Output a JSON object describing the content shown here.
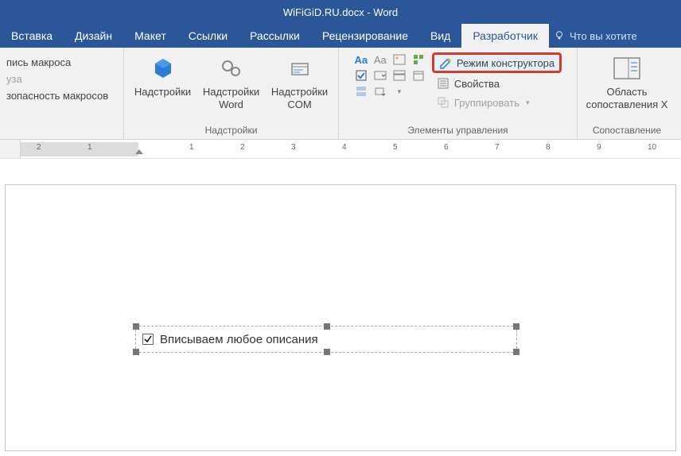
{
  "title": "WiFiGiD.RU.docx - Word",
  "tabs": [
    "Вставка",
    "Дизайн",
    "Макет",
    "Ссылки",
    "Рассылки",
    "Рецензирование",
    "Вид",
    "Разработчик"
  ],
  "active_tab": 7,
  "tell_me": "Что вы хотите",
  "code": {
    "record": "пись макроса",
    "pause": "уза",
    "security": "зопасность макросов"
  },
  "addins": {
    "label": "Надстройки",
    "items": [
      "Надстройки",
      "Надстройки Word",
      "Надстройки COM"
    ]
  },
  "controls": {
    "label": "Элементы управления",
    "design_mode": "Режим конструктора",
    "properties": "Свойства",
    "group": "Группировать"
  },
  "mapping": {
    "label": "Сопоставление",
    "pane": "Область сопоставления X"
  },
  "ruler_numbers": [
    "2",
    "1",
    "1",
    "2",
    "3",
    "4",
    "5",
    "6",
    "7",
    "8",
    "9",
    "10"
  ],
  "document": {
    "checkbox_checked": true,
    "placeholder_text": "Вписываем любое описания"
  },
  "colors": {
    "accent": "#2b579a",
    "highlight_border": "#d63b2a"
  }
}
